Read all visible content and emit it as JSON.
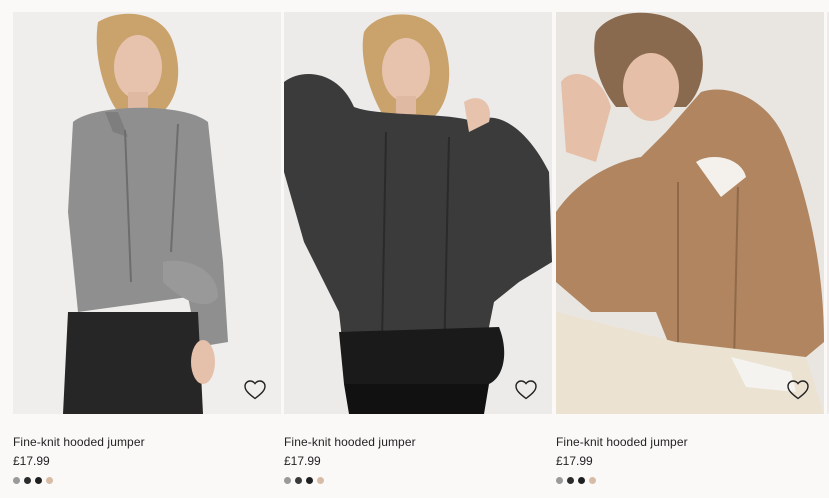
{
  "products": [
    {
      "title": "Fine-knit hooded jumper",
      "price": "£17.99",
      "image_desc": "grey hooded jumper",
      "swatches": [
        "#9a9a9a",
        "#2c2c2c",
        "#1f1f1f",
        "#d7bba4"
      ]
    },
    {
      "title": "Fine-knit hooded jumper",
      "price": "£17.99",
      "image_desc": "dark grey hooded jumper",
      "swatches": [
        "#9a9a9a",
        "#3a3a3a",
        "#1f1f1f",
        "#d7bba4"
      ]
    },
    {
      "title": "Fine-knit hooded jumper",
      "price": "£17.99",
      "image_desc": "camel hooded jumper",
      "swatches": [
        "#9a9a9a",
        "#2c2c2c",
        "#1f1f1f",
        "#d7bba4"
      ]
    }
  ],
  "icons": {
    "favourite": "heart-outline-icon"
  }
}
